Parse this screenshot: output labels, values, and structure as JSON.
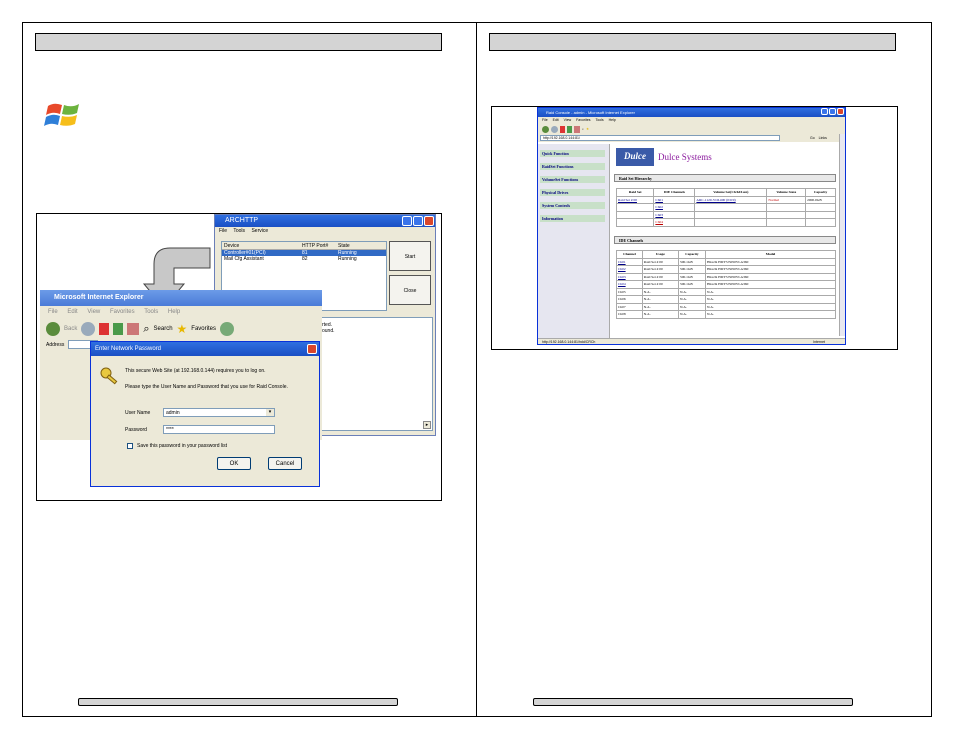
{
  "arc": {
    "title": "ARCHTTP",
    "menu": [
      "File",
      "Tools",
      "Service"
    ],
    "columns": [
      "Device",
      "HTTP Port#",
      "State"
    ],
    "rows": [
      {
        "device": "Controller#01(PCI)",
        "port": "81",
        "state": "Running"
      },
      {
        "device": "Mail Cfg Assistant",
        "port": "82",
        "state": "Running"
      }
    ],
    "start_label": "Start",
    "close_label": "Close",
    "log_lines": [
      "rted.",
      "ound."
    ]
  },
  "ie": {
    "title": "Microsoft Internet Explorer",
    "menu": [
      "File",
      "Edit",
      "View",
      "Favorites",
      "Tools",
      "Help"
    ],
    "back_label": "Back",
    "search_label": "Search",
    "favorites_label": "Favorites",
    "address_label": "Address"
  },
  "pwd": {
    "title": "Enter Network Password",
    "secure_text": "This secure Web Site (at 192.168.0.144) requires you to log on.",
    "prompt_text": "Please type the User Name and Password that you use for Raid Console.",
    "username_label": "User Name",
    "username_value": "admin",
    "password_label": "Password",
    "password_value": "****",
    "save_label": "Save this password in your password list",
    "ok_label": "OK",
    "cancel_label": "Cancel"
  },
  "rc": {
    "title": "Raid Console - admin - Microsoft Internet Explorer",
    "menu": [
      "File",
      "Edit",
      "View",
      "Favorites",
      "Tools",
      "Help"
    ],
    "address": "http://192.168.0.144:81/",
    "go_label": "Go",
    "links_label": "Links",
    "nav": [
      "Quick Function",
      "RaidSet Functions",
      "VolumeSet Functions",
      "Physical Drives",
      "System Controls",
      "Information"
    ],
    "logo_text": "Dulce",
    "brand": "Dulce Systems",
    "hierarchy_title": "Raid Set Hierarchy",
    "hierarchy_cols": [
      "Raid Set",
      "IDE Channels",
      "Volume Set(Ch/Id/Lun)",
      "Volume State",
      "Capacity"
    ],
    "hierarchy_rows": [
      {
        "raidset": "Raid Set # 00",
        "channel": "Ch01",
        "volume": "ARC-1120-VOL#00 (0/0/0)",
        "state": "Normal",
        "capacity": "2000.0GB"
      },
      {
        "raidset": "",
        "channel": "Ch02",
        "volume": "",
        "state": "",
        "capacity": ""
      },
      {
        "raidset": "",
        "channel": "Ch03",
        "volume": "",
        "state": "",
        "capacity": ""
      },
      {
        "raidset": "",
        "channel": "Ch04",
        "volume": "",
        "state": "",
        "capacity": ""
      }
    ],
    "ide_title": "IDE Channels",
    "ide_cols": [
      "Channel",
      "Usage",
      "Capacity",
      "Model"
    ],
    "ide_rows": [
      {
        "channel": "Ch01",
        "usage": "Raid Set # 00",
        "capacity": "500.1GB",
        "model": "Hitachi HDT725050VLA360"
      },
      {
        "channel": "Ch02",
        "usage": "Raid Set # 00",
        "capacity": "500.1GB",
        "model": "Hitachi HDT725050VLA360"
      },
      {
        "channel": "Ch03",
        "usage": "Raid Set # 00",
        "capacity": "500.1GB",
        "model": "Hitachi HDT725050VLA360"
      },
      {
        "channel": "Ch04",
        "usage": "Raid Set # 00",
        "capacity": "500.1GB",
        "model": "Hitachi HDT725050VLA360"
      },
      {
        "channel": "Ch05",
        "usage": "N.A.",
        "capacity": "N.A.",
        "model": "N.A."
      },
      {
        "channel": "Ch06",
        "usage": "N.A.",
        "capacity": "N.A.",
        "model": "N.A."
      },
      {
        "channel": "Ch07",
        "usage": "N.A.",
        "capacity": "N.A.",
        "model": "N.A."
      },
      {
        "channel": "Ch08",
        "usage": "N.A.",
        "capacity": "N.A.",
        "model": "N.A."
      }
    ],
    "status_text": "http://192.168.0.144:81/hdd/CRCh",
    "zone_label": "Internet"
  }
}
